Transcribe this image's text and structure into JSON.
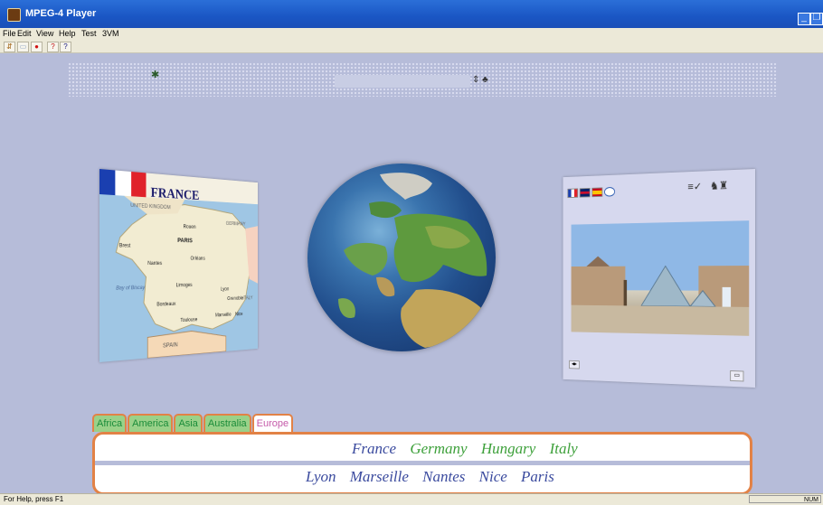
{
  "window": {
    "title": "MPEG-4 Player",
    "min_glyph": "_",
    "restore_glyph": "❐"
  },
  "menu": [
    "File",
    "Edit",
    "View",
    "Help",
    "Test",
    "3VM"
  ],
  "toolbar": {
    "icons": [
      "open-icon",
      "stop-icon",
      "record-icon",
      "help-icon",
      "context-help-icon"
    ],
    "glyphs": [
      "⇵",
      "▭",
      "●",
      "?",
      "?"
    ]
  },
  "header": {
    "person_glyph": "✱",
    "stepper_glyph": "⇕ ♣"
  },
  "map_card": {
    "country": "FRANCE",
    "flag_colors": [
      "#1a3fb0",
      "#ffffff",
      "#e0222a"
    ],
    "labels": [
      "UNITED KINGDOM",
      "GERMANY",
      "PARIS",
      "Brest",
      "Nantes",
      "Limoges",
      "Bordeaux",
      "Toulouse",
      "Marseille",
      "SPAIN",
      "Bay of Biscay",
      "Lyon",
      "ITALY",
      "Nice",
      "Orléans",
      "Rouen",
      "Grenoble"
    ]
  },
  "photo_card": {
    "icon_glyphs": [
      "≡✓",
      "♞♜"
    ],
    "pager_left": "◂▸",
    "pager_right": "▭"
  },
  "tabs": [
    {
      "label": "Africa",
      "active": false
    },
    {
      "label": "America",
      "active": false
    },
    {
      "label": "Asia",
      "active": false
    },
    {
      "label": "Australia",
      "active": false
    },
    {
      "label": "Europe",
      "active": true
    }
  ],
  "countries": [
    {
      "name": "France",
      "color": "#3a4a9e"
    },
    {
      "name": "Germany",
      "color": "#3da03a"
    },
    {
      "name": "Hungary",
      "color": "#3da03a"
    },
    {
      "name": "Italy",
      "color": "#3da03a"
    }
  ],
  "cities": [
    "Lyon",
    "Marseille",
    "Nantes",
    "Nice",
    "Paris"
  ],
  "status": {
    "left": "For Help, press F1",
    "right": "NUM"
  },
  "colors": {
    "accent_orange": "#e28246",
    "tab_green": "#9ad189",
    "city_blue": "#3a4a9e",
    "selected_pink": "#c55aa9"
  }
}
